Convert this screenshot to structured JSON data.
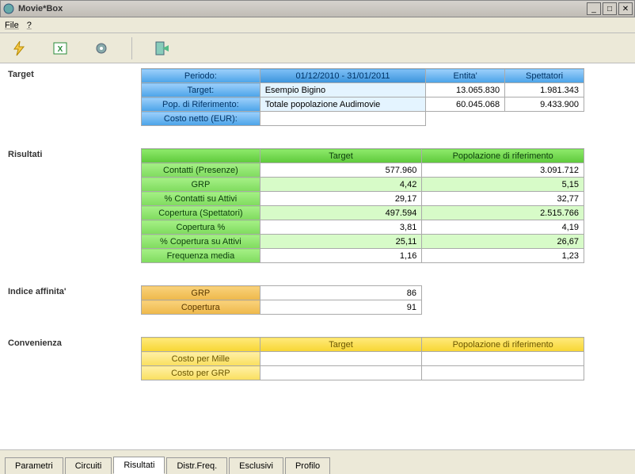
{
  "window": {
    "title": "Movie*Box"
  },
  "menu": {
    "file": "File",
    "help": "?"
  },
  "sections": {
    "target_label": "Target",
    "risultati_label": "Risultati",
    "affinita_label": "Indice affinita'",
    "convenienza_label": "Convenienza"
  },
  "target": {
    "periodo_label": "Periodo:",
    "periodo_value": "01/12/2010 - 31/01/2011",
    "entita_label": "Entita'",
    "spettatori_label": "Spettatori",
    "target_label": "Target:",
    "target_value": "Esempio Bigino",
    "entita_1": "13.065.830",
    "spett_1": "1.981.343",
    "pop_label": "Pop. di Riferimento:",
    "pop_value": "Totale popolazione Audimovie",
    "entita_2": "60.045.068",
    "spett_2": "9.433.900",
    "costo_label": "Costo netto (EUR):",
    "costo_value": ""
  },
  "risultati": {
    "col_target": "Target",
    "col_pop": "Popolazione di riferimento",
    "rows": {
      "contatti": {
        "label": "Contatti (Presenze)",
        "t": "577.960",
        "p": "3.091.712"
      },
      "grp": {
        "label": "GRP",
        "t": "4,42",
        "p": "5,15"
      },
      "pct_contatti": {
        "label": "% Contatti su Attivi",
        "t": "29,17",
        "p": "32,77"
      },
      "copertura": {
        "label": "Copertura (Spettatori)",
        "t": "497.594",
        "p": "2.515.766"
      },
      "copertura_pct": {
        "label": "Copertura %",
        "t": "3,81",
        "p": "4,19"
      },
      "pct_copertura": {
        "label": "% Copertura su Attivi",
        "t": "25,11",
        "p": "26,67"
      },
      "freq": {
        "label": "Frequenza media",
        "t": "1,16",
        "p": "1,23"
      }
    }
  },
  "affinita": {
    "grp_label": "GRP",
    "grp_value": "86",
    "cop_label": "Copertura",
    "cop_value": "91"
  },
  "convenienza": {
    "col_target": "Target",
    "col_pop": "Popolazione di riferimento",
    "costo_mille": "Costo per Mille",
    "costo_grp": "Costo per GRP"
  },
  "tabs": {
    "parametri": "Parametri",
    "circuiti": "Circuiti",
    "risultati": "Risultati",
    "distrfreq": "Distr.Freq.",
    "esclusivi": "Esclusivi",
    "profilo": "Profilo"
  }
}
